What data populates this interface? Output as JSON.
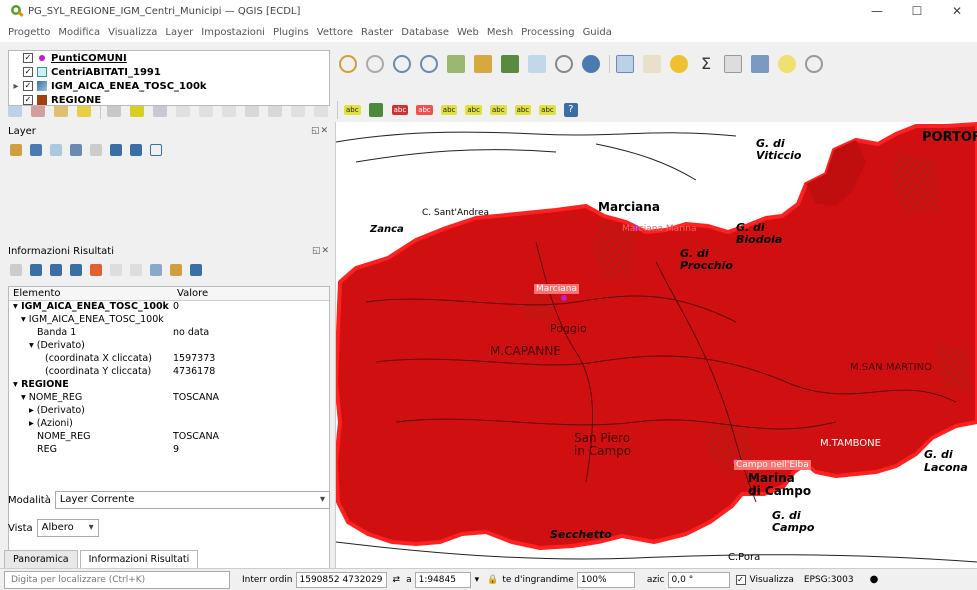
{
  "window": {
    "title": "PG_SYL_REGIONE_IGM_Centri_Municipi — QGIS [ECDL]",
    "minimize": "—",
    "maximize": "☐",
    "close": "✕"
  },
  "menu": [
    "Progetto",
    "Modifica",
    "Visualizza",
    "Layer",
    "Impostazioni",
    "Plugins",
    "Vettore",
    "Raster",
    "Database",
    "Web",
    "Mesh",
    "Processing",
    "Guida"
  ],
  "layers_panel": {
    "title": "Layer",
    "items": [
      {
        "name": "PuntiCOMUNI",
        "checked": "✓",
        "expander": "",
        "symbol_color": "#c020c0"
      },
      {
        "name": "CentriABITATI_1991",
        "checked": "✓",
        "expander": "",
        "symbol_color": "#7fd0ff"
      },
      {
        "name": "IGM_AICA_ENEA_TOSC_100k",
        "checked": "✓",
        "expander": "▸",
        "symbol_color": "#3a6ea5"
      },
      {
        "name": "REGIONE",
        "checked": "✓",
        "expander": "",
        "symbol_color": "#a04010"
      }
    ]
  },
  "identify_panel": {
    "title": "Informazioni Risultati",
    "col_elemento": "Elemento",
    "col_valore": "Valore",
    "rows": [
      {
        "label": "▾ IGM_AICA_ENEA_TOSC_100k",
        "value": "0",
        "bold": true,
        "indent": 0
      },
      {
        "label": "▾ IGM_AICA_ENEA_TOSC_100k",
        "value": "",
        "bold": false,
        "indent": 1
      },
      {
        "label": "Banda 1",
        "value": "no data",
        "bold": false,
        "indent": 3
      },
      {
        "label": "▾ (Derivato)",
        "value": "",
        "bold": false,
        "indent": 2
      },
      {
        "label": "(coordinata X cliccata)",
        "value": "1597373",
        "bold": false,
        "indent": 4
      },
      {
        "label": "(coordinata Y cliccata)",
        "value": "4736178",
        "bold": false,
        "indent": 4
      },
      {
        "label": "▾ REGIONE",
        "value": "",
        "bold": true,
        "indent": 0
      },
      {
        "label": "▾ NOME_REG",
        "value": "TOSCANA",
        "bold": false,
        "indent": 1
      },
      {
        "label": "▸ (Derivato)",
        "value": "",
        "bold": false,
        "indent": 2
      },
      {
        "label": "▸ (Azioni)",
        "value": "",
        "bold": false,
        "indent": 2
      },
      {
        "label": "NOME_REG",
        "value": "TOSCANA",
        "bold": false,
        "indent": 3
      },
      {
        "label": "REG",
        "value": "9",
        "bold": false,
        "indent": 3
      }
    ],
    "mode_label": "Modalità",
    "mode_value": "Layer Corrente",
    "view_label": "Vista",
    "view_value": "Albero"
  },
  "dock_tabs": [
    "Panoramica",
    "Informazioni Risultati"
  ],
  "map": {
    "labels": {
      "marciana": "Marciana",
      "marciana_marina": "Marciana Marina",
      "marciana_pin": "Marciana",
      "campo": "Campo nell'Elba",
      "portof": "PORTOF",
      "viticcio": "G. di\nViticcio",
      "capanne": "M.CAPANNE",
      "procchio": "G. di\nProcchio",
      "biodola": "G. di\nBiodola",
      "tambone": "M.TAMBONE",
      "marina_di_campo": "Marina\ndi Campo",
      "golfo_campo": "G. di\nCampo",
      "lacona": "G. di\nLacona",
      "san_piero": "San Piero\nin Campo",
      "secchetto": "Secchetto",
      "sant_andrea": "C. Sant'Andrea",
      "zanca": "Zanca",
      "poggio": "Poggio",
      "pora": "C.Pora",
      "san_martino": "M.SAN MARTINO"
    },
    "fill_color": "#d01010",
    "stroke_color": "#ff2020"
  },
  "status": {
    "locator_placeholder": "Digita per localizzare (Ctrl+K)",
    "coord_label": "Interr ordin",
    "coord_value": "1590852 4732029",
    "scale_label": "a",
    "scale_value": "1:94845",
    "magnifier_label": "te d'ingrandime",
    "magnifier_value": "100%",
    "rotation_label": "azic",
    "rotation_value": "0,0 °",
    "render_label": "Visualizza",
    "crs": "EPSG:3003"
  }
}
